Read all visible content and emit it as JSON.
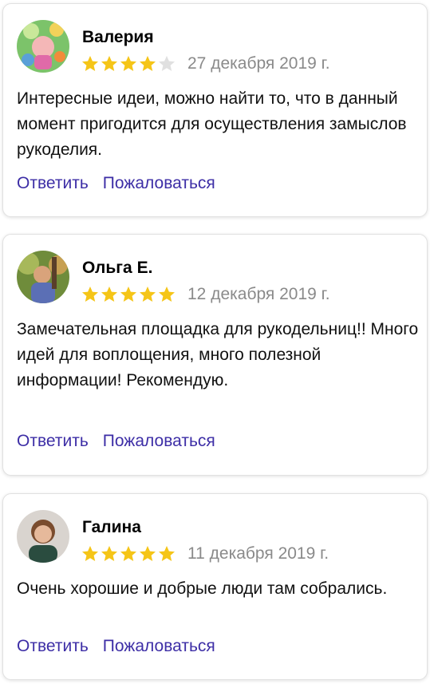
{
  "reviews": [
    {
      "name": "Валерия",
      "rating": 4,
      "date": "27 декабря 2019 г.",
      "text": "Интересные идеи, можно найти то, что в данный момент пригодится для осуществления замыслов рукоделия.",
      "reply_label": "Ответить",
      "report_label": "Пожаловаться"
    },
    {
      "name": "Ольга Е.",
      "rating": 5,
      "date": "12 декабря 2019 г.",
      "text": "Замечательная площадка для рукодельниц!! Много идей для воплощения, много полезной информации! Рекомендую.",
      "reply_label": "Ответить",
      "report_label": "Пожаловаться"
    },
    {
      "name": "Галина",
      "rating": 5,
      "date": "11 декабря 2019 г.",
      "text": "Очень хорошие и добрые люди там собрались.",
      "reply_label": "Ответить",
      "report_label": "Пожаловаться"
    }
  ],
  "colors": {
    "star_filled": "#f5c518",
    "star_empty": "#e0e0e0",
    "link": "#3d2ea6",
    "date": "#8a8a8a"
  }
}
